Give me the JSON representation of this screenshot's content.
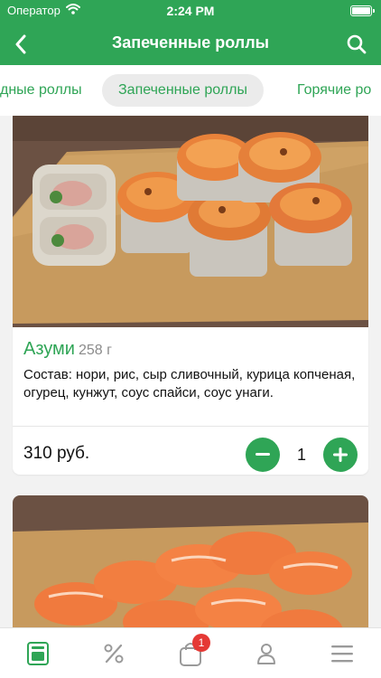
{
  "status_bar": {
    "carrier": "Оператор",
    "time": "2:24 PM"
  },
  "header": {
    "title": "Запеченные роллы"
  },
  "category_tabs": [
    {
      "label": "дные роллы",
      "active": false
    },
    {
      "label": "Запеченные роллы",
      "active": true
    },
    {
      "label": "Горячие ро",
      "active": false
    }
  ],
  "products": [
    {
      "name": "Азуми",
      "weight": "258 г",
      "description": "Состав: нори, рис, сыр сливочный, курица копченая, огурец, кунжут, соус спайси, соус унаги.",
      "price": "310 руб.",
      "quantity": "1"
    }
  ],
  "bottom_nav": {
    "items": [
      {
        "icon": "menu-book-icon",
        "active": true
      },
      {
        "icon": "percent-icon",
        "active": false
      },
      {
        "icon": "cart-bag-icon",
        "active": false
      },
      {
        "icon": "profile-icon",
        "active": false
      },
      {
        "icon": "hamburger-menu-icon",
        "active": false
      }
    ],
    "cart_badge": "1"
  },
  "colors": {
    "accent": "#2fa556",
    "badge": "#e53935",
    "background": "#f2f2f2"
  }
}
